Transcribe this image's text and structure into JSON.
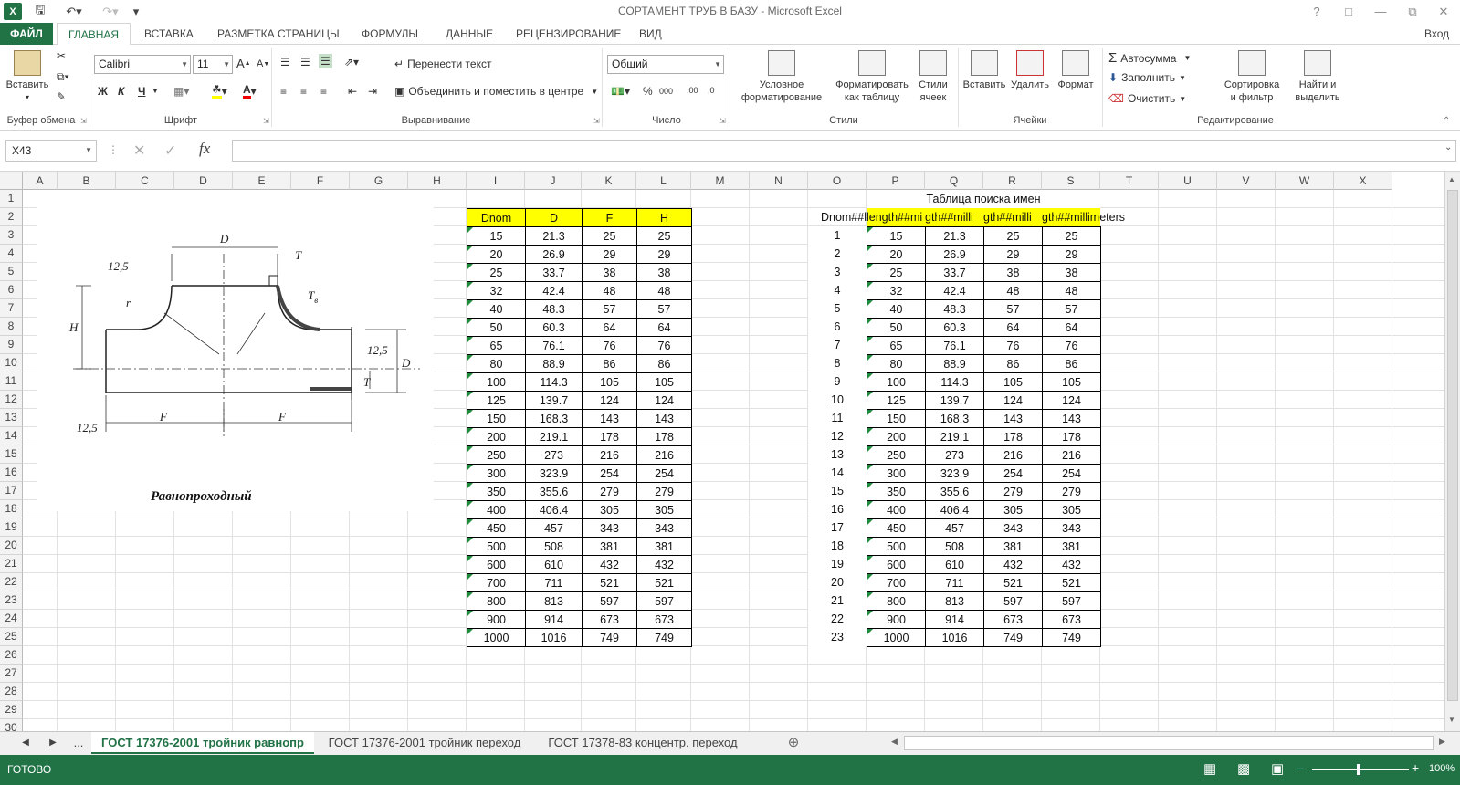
{
  "app": {
    "title": "СОРТАМЕНТ ТРУБ В БАЗУ - Microsoft Excel",
    "user": "Вход"
  },
  "tabs": [
    "ФАЙЛ",
    "ГЛАВНАЯ",
    "ВСТАВКА",
    "РАЗМЕТКА СТРАНИЦЫ",
    "ФОРМУЛЫ",
    "ДАННЫЕ",
    "РЕЦЕНЗИРОВАНИЕ",
    "ВИД"
  ],
  "ribbon": {
    "clipboard": {
      "paste": "Вставить",
      "group": "Буфер обмена"
    },
    "font": {
      "name": "Calibri",
      "size": "11",
      "bold": "Ж",
      "italic": "К",
      "underline": "Ч",
      "group": "Шрифт"
    },
    "alignment": {
      "wrap": "Перенести текст",
      "merge": "Объединить и поместить в центре",
      "group": "Выравнивание"
    },
    "number": {
      "format": "Общий",
      "group": "Число"
    },
    "styles": {
      "conditional": "Условное\nформатирование",
      "as_table": "Форматировать\nкак таблицу",
      "cell_styles": "Стили\nячеек",
      "group": "Стили"
    },
    "cells": {
      "insert": "Вставить",
      "delete": "Удалить",
      "format": "Формат",
      "group": "Ячейки"
    },
    "editing": {
      "autosum": "Автосумма",
      "fill": "Заполнить",
      "clear": "Очистить",
      "sort": "Сортировка\nи фильтр",
      "find": "Найти и\nвыделить",
      "group": "Редактирование"
    }
  },
  "formula_bar": {
    "name_box": "X43",
    "formula": ""
  },
  "columns": [
    "A",
    "B",
    "C",
    "D",
    "E",
    "F",
    "G",
    "H",
    "I",
    "J",
    "K",
    "L",
    "M",
    "N",
    "O",
    "P",
    "Q",
    "R",
    "S",
    "T",
    "U",
    "V",
    "W",
    "X"
  ],
  "rows": [
    "1",
    "2",
    "3",
    "4",
    "5",
    "6",
    "7",
    "8",
    "9",
    "10",
    "11",
    "12",
    "13",
    "14",
    "15",
    "16",
    "17",
    "18",
    "19",
    "20",
    "21",
    "22",
    "23",
    "24",
    "25",
    "26",
    "27",
    "28",
    "29",
    "30"
  ],
  "image": {
    "caption": "Равнопроходный",
    "labels": {
      "D": "D",
      "T": "T",
      "r": "r",
      "Tb": "T",
      "Tb_sub": "в",
      "H": "H",
      "F1": "F",
      "F2": "F",
      "d125a": "12,5",
      "d125b": "12,5",
      "d125c": "12,5",
      "Dr": "D",
      "Tr": "T"
    }
  },
  "table1": {
    "headers": [
      "Dnom",
      "D",
      "F",
      "H"
    ],
    "rows": [
      [
        "15",
        "21.3",
        "25",
        "25"
      ],
      [
        "20",
        "26.9",
        "29",
        "29"
      ],
      [
        "25",
        "33.7",
        "38",
        "38"
      ],
      [
        "32",
        "42.4",
        "48",
        "48"
      ],
      [
        "40",
        "48.3",
        "57",
        "57"
      ],
      [
        "50",
        "60.3",
        "64",
        "64"
      ],
      [
        "65",
        "76.1",
        "76",
        "76"
      ],
      [
        "80",
        "88.9",
        "86",
        "86"
      ],
      [
        "100",
        "114.3",
        "105",
        "105"
      ],
      [
        "125",
        "139.7",
        "124",
        "124"
      ],
      [
        "150",
        "168.3",
        "143",
        "143"
      ],
      [
        "200",
        "219.1",
        "178",
        "178"
      ],
      [
        "250",
        "273",
        "216",
        "216"
      ],
      [
        "300",
        "323.9",
        "254",
        "254"
      ],
      [
        "350",
        "355.6",
        "279",
        "279"
      ],
      [
        "400",
        "406.4",
        "305",
        "305"
      ],
      [
        "450",
        "457",
        "343",
        "343"
      ],
      [
        "500",
        "508",
        "381",
        "381"
      ],
      [
        "600",
        "610",
        "432",
        "432"
      ],
      [
        "700",
        "711",
        "521",
        "521"
      ],
      [
        "800",
        "813",
        "597",
        "597"
      ],
      [
        "900",
        "914",
        "673",
        "673"
      ],
      [
        "1000",
        "1016",
        "749",
        "749"
      ]
    ]
  },
  "table2": {
    "title": "Таблица поиска имен",
    "headers": [
      "Dnom##l",
      "length##mi",
      "gth##milli",
      "gth##milli",
      "gth##millimeters"
    ],
    "index": [
      "1",
      "2",
      "3",
      "4",
      "5",
      "6",
      "7",
      "8",
      "9",
      "10",
      "11",
      "12",
      "13",
      "14",
      "15",
      "16",
      "17",
      "18",
      "19",
      "20",
      "21",
      "22",
      "23"
    ]
  },
  "sheets": {
    "ellipsis": "...",
    "tabs": [
      "ГОСТ 17376-2001 тройник равнопр",
      "ГОСТ 17376-2001 тройник переход",
      "ГОСТ 17378-83 концентр. переход"
    ]
  },
  "status": {
    "text": "ГОТОВО",
    "zoom": "100%"
  },
  "colors": {
    "accent": "#217346",
    "header_yellow": "#ffff00"
  }
}
